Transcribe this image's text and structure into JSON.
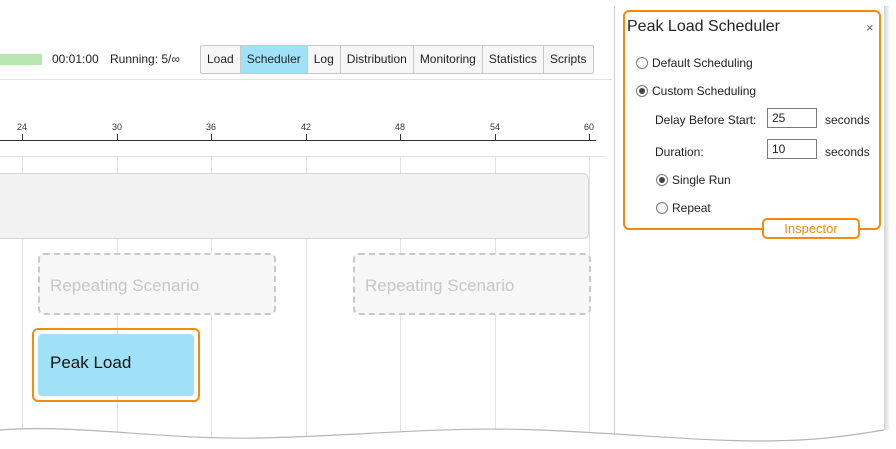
{
  "toolbar": {
    "elapsed": "00:01:00",
    "running": "Running: 5/∞",
    "progress_color": "#b8e6b0",
    "tabs": [
      {
        "label": "Load",
        "active": false
      },
      {
        "label": "Scheduler",
        "active": true
      },
      {
        "label": "Log",
        "active": false
      },
      {
        "label": "Distribution",
        "active": false
      },
      {
        "label": "Monitoring",
        "active": false
      },
      {
        "label": "Statistics",
        "active": false
      },
      {
        "label": "Scripts",
        "active": false
      }
    ]
  },
  "ruler": {
    "labels": [
      "24",
      "30",
      "36",
      "42",
      "48",
      "54",
      "60"
    ]
  },
  "timeline": {
    "repeating_a": "Repeating Scenario",
    "repeating_b": "Repeating Scenario",
    "peak": "Peak Load"
  },
  "inspector": {
    "title": "Peak Load Scheduler",
    "close": "×",
    "default_scheduling": "Default Scheduling",
    "custom_scheduling": "Custom Scheduling",
    "delay_label": "Delay Before Start:",
    "delay_value": "25",
    "delay_unit": "seconds",
    "duration_label": "Duration:",
    "duration_value": "10",
    "duration_unit": "seconds",
    "single_run": "Single Run",
    "repeat": "Repeat",
    "selected_mode": "Custom Scheduling",
    "selected_run": "Single Run",
    "callout": "Inspector"
  },
  "colors": {
    "accent_orange": "#f28c0f",
    "selected_blue": "#9fe2f7"
  }
}
